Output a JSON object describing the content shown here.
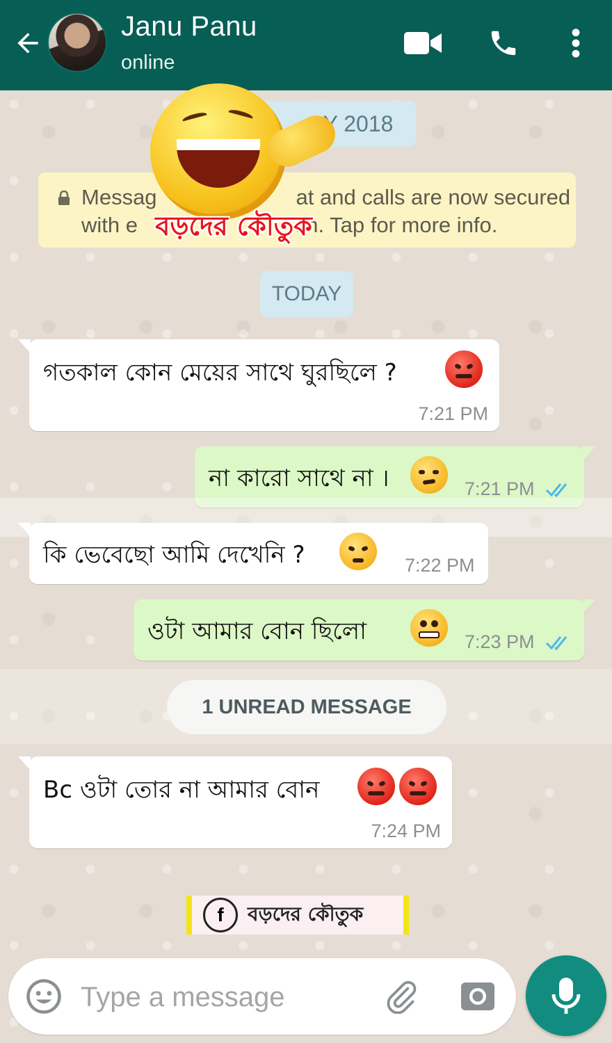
{
  "header": {
    "contact_name": "Janu Panu",
    "status": "online",
    "color": "#075e54"
  },
  "icons": {
    "back": "arrow-left-icon",
    "video": "video-camera-icon",
    "call": "phone-icon",
    "menu": "more-vertical-icon",
    "emoji": "smiley-icon",
    "attach": "paperclip-icon",
    "camera": "camera-icon",
    "mic": "microphone-icon",
    "lock": "lock-icon"
  },
  "date_label": "Y 2018",
  "encryption_notice": {
    "line1": "Messag",
    "line1_end": "at and calls are now secured",
    "line2": "with e",
    "line2_end": "on. Tap for more info."
  },
  "today_label": "TODAY",
  "messages": [
    {
      "direction": "in",
      "text": "গতকাল কোন মেয়ের সাথে ঘুরছিলে ?",
      "time": "7:21 PM",
      "emoji": "angry-face"
    },
    {
      "direction": "out",
      "text": "না কারো সাথে না ।",
      "time": "7:21 PM",
      "emoji": "unamused-face",
      "read": true
    },
    {
      "direction": "in",
      "text": "কি ভেবেছো আমি দেখেনি ?",
      "time": "7:22 PM",
      "emoji": "annoyed-face"
    },
    {
      "direction": "out",
      "text": "ওটা আমার বোন  ছিলো",
      "time": "7:23 PM",
      "emoji": "grinning-face",
      "read": true
    },
    {
      "direction": "in",
      "text": "Bc ওটা তোর না আমার বোন",
      "time": "7:24 PM",
      "emoji": "angry-face-x2"
    }
  ],
  "unread_label": "1 UNREAD MESSAGE",
  "watermark": {
    "sticker_label": "বড়দের কৌতুক",
    "fb_letter": "f",
    "fb_label": "বড়দের কৌতুক"
  },
  "input": {
    "placeholder": "Type a message",
    "value": ""
  },
  "colors": {
    "incoming": "#ffffff",
    "outgoing": "#dcf8c6",
    "read_tick": "#4fb6ec",
    "fab": "#128c7e"
  }
}
